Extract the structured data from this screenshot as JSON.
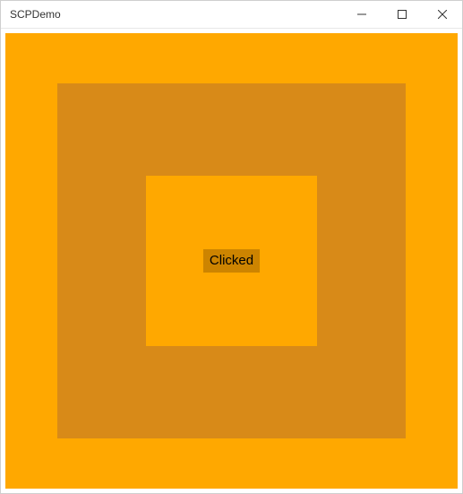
{
  "window": {
    "title": "SCPDemo"
  },
  "button": {
    "label": "Clicked"
  },
  "colors": {
    "outer": "#ffa800",
    "middle": "#d88a18",
    "inner": "#ffa800",
    "button_bg": "#cd8400"
  }
}
